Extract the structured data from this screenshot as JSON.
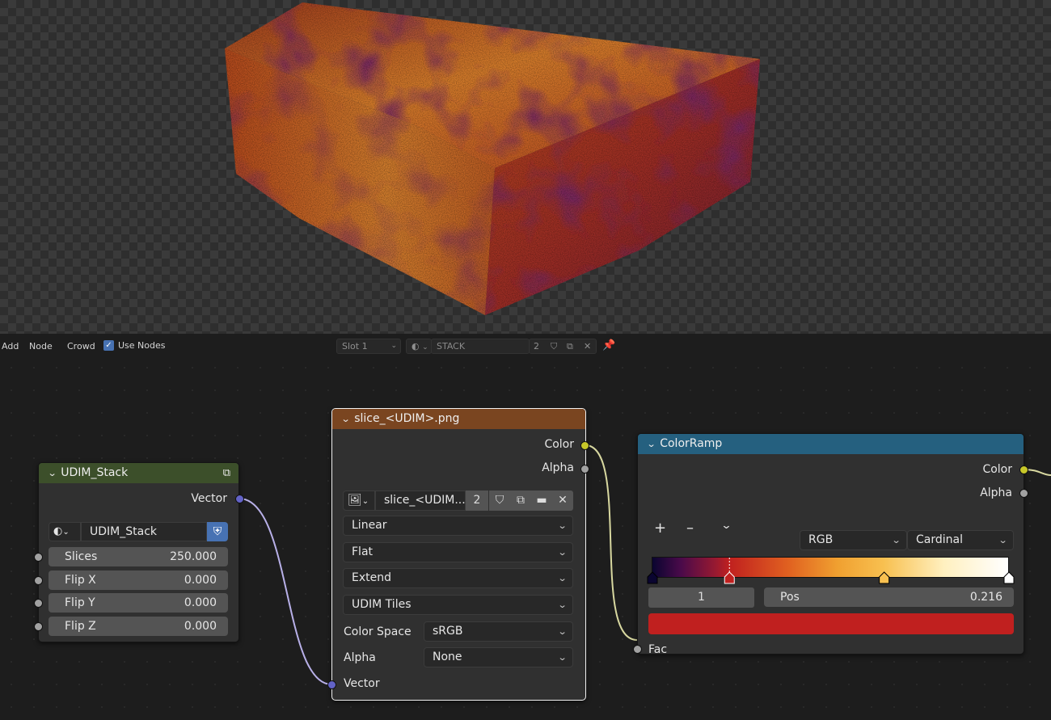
{
  "header": {
    "menus": [
      "Add",
      "Node",
      "Crowd"
    ],
    "use_nodes_label": "Use Nodes",
    "slot": "Slot 1",
    "material_name": "STACK",
    "material_users": "2"
  },
  "udim_node": {
    "title": "UDIM_Stack",
    "output": "Vector",
    "group_name": "UDIM_Stack",
    "inputs": [
      {
        "label": "Slices",
        "value": "250.000"
      },
      {
        "label": "Flip X",
        "value": "0.000"
      },
      {
        "label": "Flip Y",
        "value": "0.000"
      },
      {
        "label": "Flip Z",
        "value": "0.000"
      }
    ],
    "header_color": "#3c4f2a"
  },
  "image_node": {
    "title": "slice_<UDIM>.png",
    "outputs": [
      "Color",
      "Alpha"
    ],
    "image_name": "slice_<UDIM...",
    "image_users": "2",
    "interpolation": "Linear",
    "projection": "Flat",
    "extension": "Extend",
    "source": "UDIM Tiles",
    "color_space_label": "Color Space",
    "color_space": "sRGB",
    "alpha_label": "Alpha",
    "alpha": "None",
    "input": "Vector",
    "header_color": "#7a4520"
  },
  "colorramp_node": {
    "title": "ColorRamp",
    "outputs": [
      "Color",
      "Alpha"
    ],
    "add_symbol": "+",
    "remove_symbol": "–",
    "color_mode": "RGB",
    "interpolation": "Cardinal",
    "active_index": "1",
    "pos_label": "Pos",
    "pos_value": "0.216",
    "active_color": "#c0201f",
    "input": "Fac",
    "header_color": "#25607f",
    "stops": [
      {
        "pos": 0.0,
        "color": "#0a0530"
      },
      {
        "pos": 0.216,
        "color": "#c0201f"
      },
      {
        "pos": 0.65,
        "color": "#f8c050"
      },
      {
        "pos": 1.0,
        "color": "#ffffff"
      }
    ]
  }
}
